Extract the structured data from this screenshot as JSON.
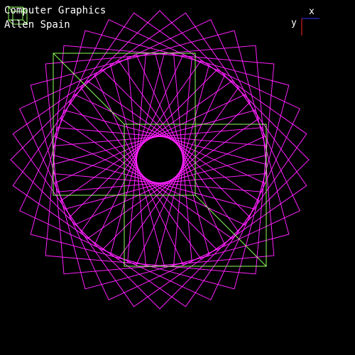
{
  "window": {
    "title": "Computer Graphics",
    "author": "Allen Spain"
  },
  "axes_gizmo": {
    "x_label": "x",
    "y_label": "y",
    "x_color": "#3030ff",
    "y_color": "#ff2020"
  },
  "scene": {
    "background": "#000000",
    "pattern_color": "#ff20ff",
    "square_color": "#90ff60",
    "corner_icon": "wireframe-cube-icon",
    "pattern_shape": "rotated-squares-spirograph",
    "pattern_count": 36,
    "square_count": 2
  }
}
